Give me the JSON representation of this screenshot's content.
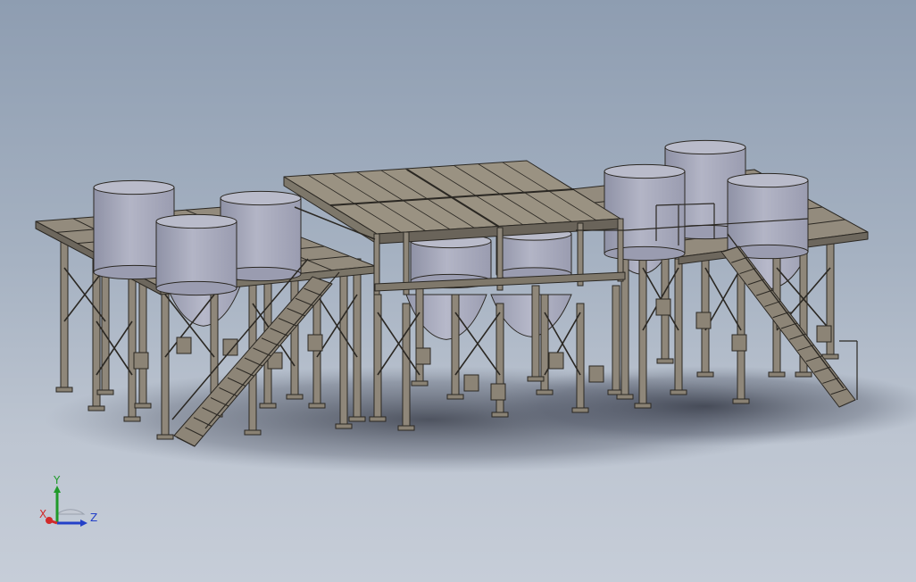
{
  "viewport": {
    "background_top": "#8e9db1",
    "background_bottom": "#c6cdd8"
  },
  "model": {
    "description_icon": "steel-hopper-platform-model",
    "steel_color": "#8f877a",
    "steel_dark": "#2b2823",
    "tank_color": "#a9abbc",
    "tank_top_color": "#b9bbca"
  },
  "triad": {
    "x_label": "X",
    "y_label": "Y",
    "z_label": "Z",
    "x_color": "#d12a2a",
    "y_color": "#1f9a2a",
    "z_color": "#2340c8"
  }
}
